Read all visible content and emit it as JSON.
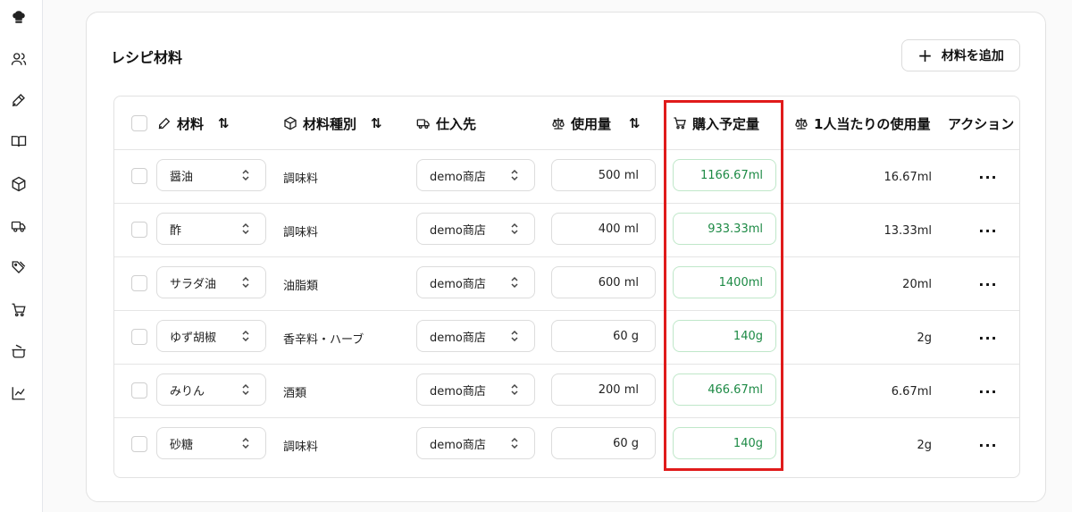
{
  "sidebar": {
    "icons": [
      "chef-hat-icon",
      "users-icon",
      "pen-icon",
      "book-icon",
      "box-icon",
      "truck-icon",
      "tags-icon",
      "cart-icon",
      "cooking-pot-icon",
      "chart-icon"
    ]
  },
  "card": {
    "title": "レシピ材料",
    "add_button": "材料を追加"
  },
  "table": {
    "headers": {
      "ingredient": "材料",
      "category": "材料種別",
      "supplier": "仕入先",
      "usage": "使用量",
      "planned": "購入予定量",
      "per_person": "1人当たりの使用量",
      "action": "アクション"
    },
    "rows": [
      {
        "ingredient": "醤油",
        "category": "調味料",
        "supplier": "demo商店",
        "usage": "500 ml",
        "planned": "1166.67ml",
        "per_person": "16.67ml"
      },
      {
        "ingredient": "酢",
        "category": "調味料",
        "supplier": "demo商店",
        "usage": "400 ml",
        "planned": "933.33ml",
        "per_person": "13.33ml"
      },
      {
        "ingredient": "サラダ油",
        "category": "油脂類",
        "supplier": "demo商店",
        "usage": "600 ml",
        "planned": "1400ml",
        "per_person": "20ml"
      },
      {
        "ingredient": "ゆず胡椒",
        "category": "香辛料・ハーブ",
        "supplier": "demo商店",
        "usage": "60 g",
        "planned": "140g",
        "per_person": "2g"
      },
      {
        "ingredient": "みりん",
        "category": "酒類",
        "supplier": "demo商店",
        "usage": "200 ml",
        "planned": "466.67ml",
        "per_person": "6.67ml"
      },
      {
        "ingredient": "砂糖",
        "category": "調味料",
        "supplier": "demo商店",
        "usage": "60 g",
        "planned": "140g",
        "per_person": "2g"
      }
    ]
  },
  "colors": {
    "highlight": "#e01b1b",
    "planned_text": "#1d8a45",
    "planned_border": "#bfe7c9"
  }
}
